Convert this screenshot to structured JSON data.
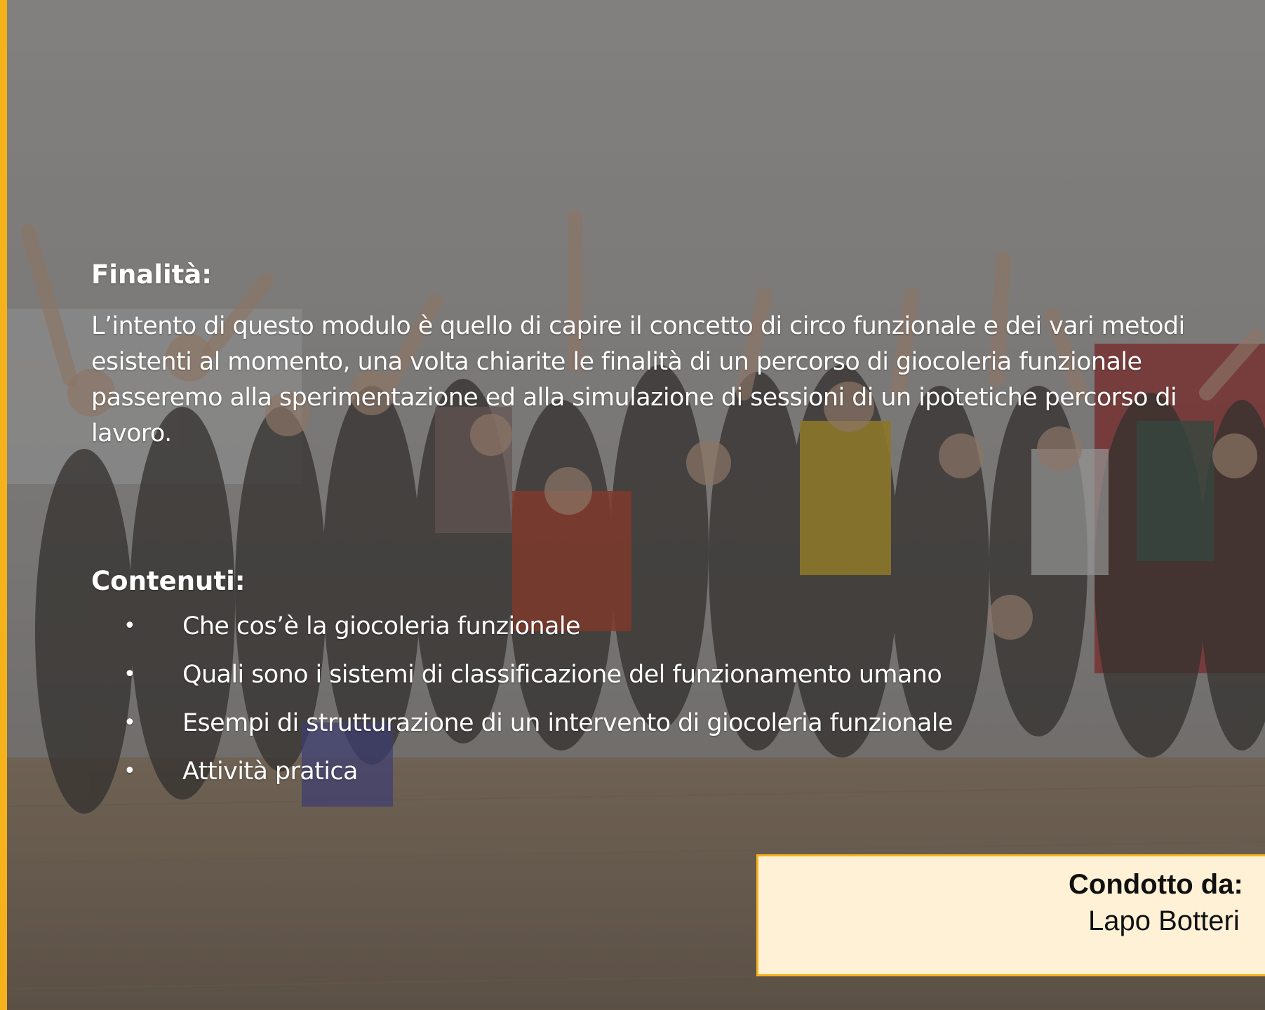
{
  "slide": {
    "colors": {
      "accent": "#f6b21b",
      "author_box_bg": "#fff1d6",
      "text_on_photo": "#ffffff",
      "author_text": "#111111"
    },
    "background_photo": "group-of-people-with-raised-arms-photo"
  },
  "purpose": {
    "heading": "Finalità:",
    "text": "L’intento di questo modulo è quello di capire il concetto di circo funzionale e dei vari metodi esistenti al momento, una volta chiarite le finalità di un percorso di giocoleria funzionale passeremo alla sperimentazione ed alla simulazione di sessioni di un ipotetiche percorso di lavoro."
  },
  "contents": {
    "heading": "Contenuti:",
    "bullet_symbol": "•",
    "items": [
      "Che cos’è la giocoleria funzionale",
      "Quali sono i sistemi di classificazione del funzionamento umano",
      "Esempi di strutturazione di un intervento di giocoleria funzionale",
      "Attività pratica"
    ]
  },
  "author": {
    "label": "Condotto da:",
    "name": "Lapo Botteri"
  }
}
